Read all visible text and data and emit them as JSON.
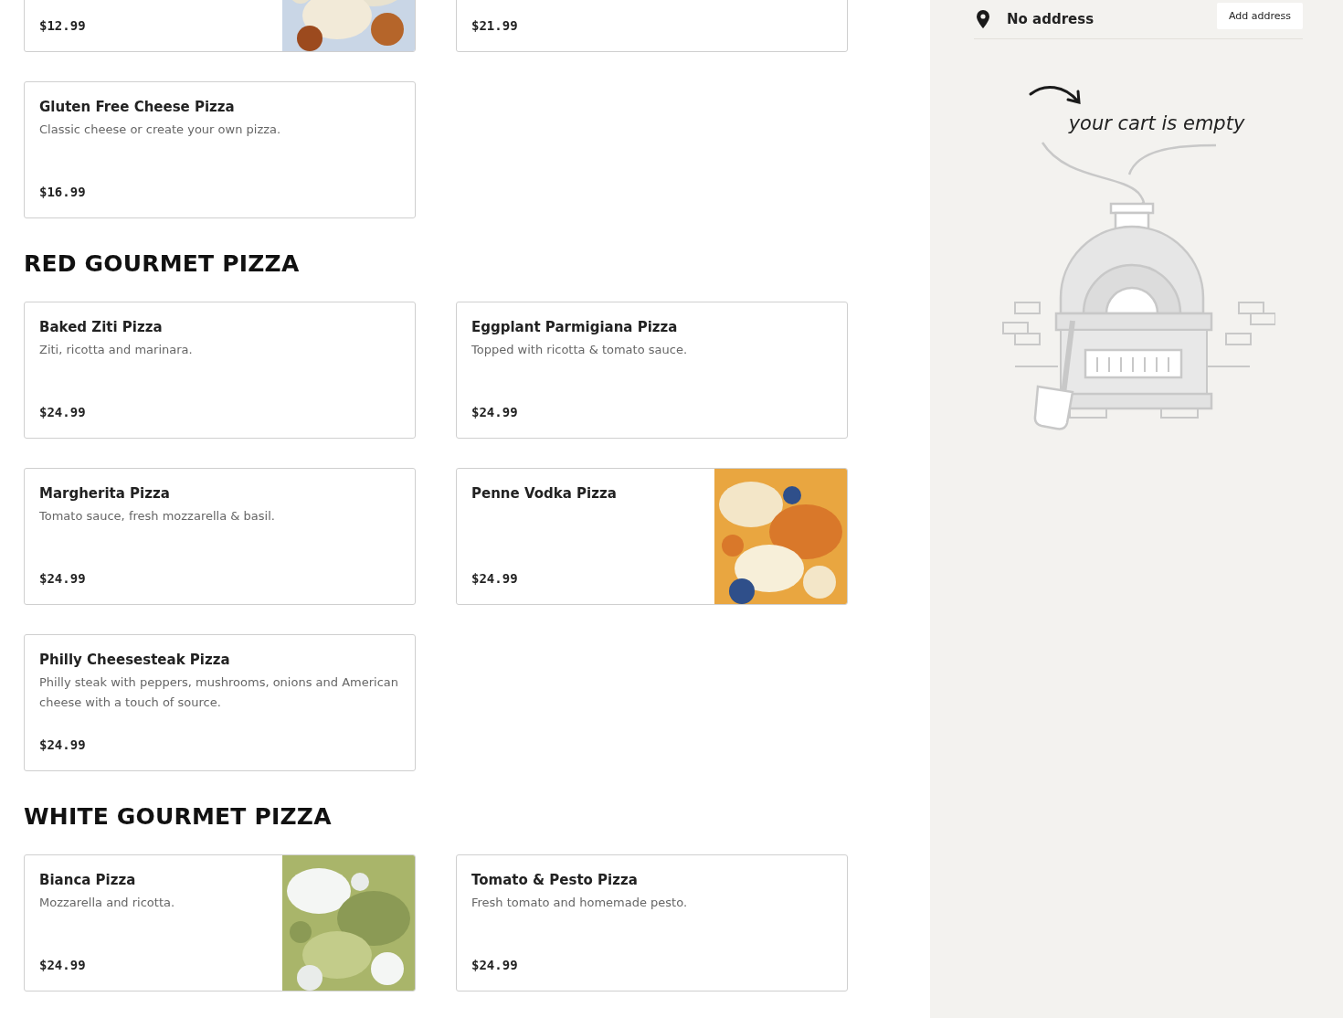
{
  "sections": [
    {
      "items": [
        {
          "price": "$12.99",
          "image": true
        },
        {
          "price": "$21.99",
          "image": false
        },
        {
          "name": "Gluten Free Cheese Pizza",
          "description": "Classic cheese or create your own pizza.",
          "price": "$16.99",
          "image": false
        }
      ]
    },
    {
      "heading": "RED GOURMET PIZZA",
      "items": [
        {
          "name": "Baked Ziti Pizza",
          "description": "Ziti, ricotta and marinara.",
          "price": "$24.99",
          "image": false
        },
        {
          "name": "Eggplant Parmigiana Pizza",
          "description": "Topped with ricotta & tomato sauce.",
          "price": "$24.99",
          "image": false
        },
        {
          "name": "Margherita Pizza",
          "description": "Tomato sauce, fresh mozzarella & basil.",
          "price": "$24.99",
          "image": false
        },
        {
          "name": "Penne Vodka Pizza",
          "price": "$24.99",
          "image": true
        },
        {
          "name": "Philly Cheesesteak Pizza",
          "description": "Philly steak with peppers, mushrooms, onions and American cheese with a touch of source.",
          "price": "$24.99",
          "image": false
        }
      ]
    },
    {
      "heading": "WHITE GOURMET PIZZA",
      "items": [
        {
          "name": "Bianca Pizza",
          "description": "Mozzarella and ricotta.",
          "price": "$24.99",
          "image": true
        },
        {
          "name": "Tomato & Pesto Pizza",
          "description": "Fresh tomato and homemade pesto.",
          "price": "$24.99",
          "image": false
        }
      ]
    }
  ],
  "cart": {
    "address": "No address",
    "add_button": "Add address",
    "empty_message": "your cart is empty"
  }
}
